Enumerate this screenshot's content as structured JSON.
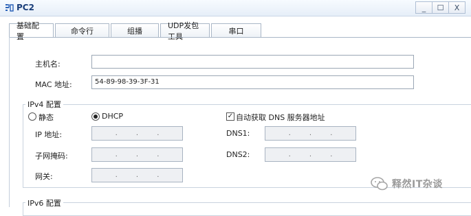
{
  "window": {
    "title": "PC2",
    "minimize": "_",
    "maximize": "☐",
    "close": "X"
  },
  "tabs": [
    "基础配置",
    "命令行",
    "组播",
    "UDP发包工具",
    "串口"
  ],
  "basic": {
    "hostname_label": "主机名:",
    "hostname_value": "",
    "mac_label": "MAC 地址:",
    "mac_value": "54-89-98-39-3F-31"
  },
  "ipv4": {
    "group_title": "IPv4 配置",
    "static_label": "静态",
    "dhcp_label": "DHCP",
    "mode_selected": "DHCP",
    "auto_dns_label": "自动获取 DNS 服务器地址",
    "auto_dns_checked": true,
    "ip_label": "IP 地址:",
    "mask_label": "子网掩码:",
    "gateway_label": "网关:",
    "dns1_label": "DNS1:",
    "dns2_label": "DNS2:",
    "ip_dots": ".",
    "ip_value": "",
    "mask_value": "",
    "gateway_value": "",
    "dns1_value": "",
    "dns2_value": ""
  },
  "ipv6": {
    "group_title": "IPv6 配置"
  },
  "watermark": {
    "text": "释然IT杂谈"
  }
}
